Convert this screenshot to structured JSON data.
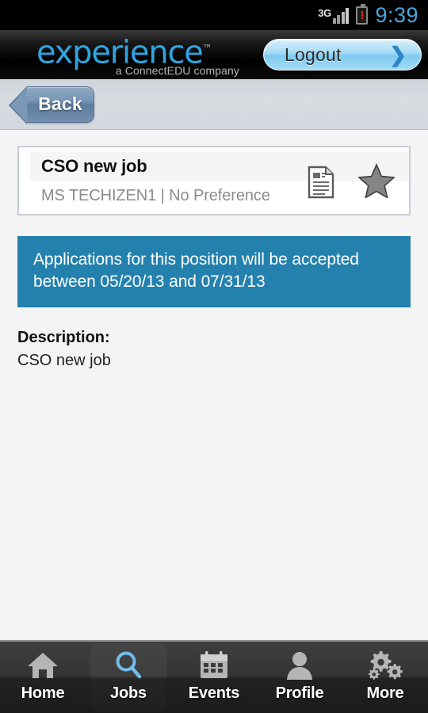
{
  "status_bar": {
    "network": "3G",
    "signal_icon": "signal-bars-icon",
    "battery_icon": "battery-alert-icon",
    "battery_alert": "!",
    "time": "9:39",
    "time_color": "#4aa8e0"
  },
  "header": {
    "logo_word": "experience",
    "logo_tm": "™",
    "logo_tagline": "a ConnectEDU company",
    "logo_color": "#2fa5e0",
    "logout_label": "Logout",
    "logout_chevron": "❯"
  },
  "nav": {
    "back_label": "Back"
  },
  "job_card": {
    "title": "CSO new job",
    "subtitle": "MS TECHIZEN1 | No Preference",
    "doc_icon": "document-icon",
    "star_icon": "star-icon",
    "star_color": "#858585"
  },
  "banner": {
    "line1": "Applications for this position will be accepted",
    "line2": "between 05/20/13 and 07/31/13",
    "background": "#2481ad"
  },
  "description": {
    "label": "Description:",
    "text": "CSO new job"
  },
  "tabbar": {
    "items": [
      {
        "label": "Home",
        "icon": "home-icon",
        "active": false
      },
      {
        "label": "Jobs",
        "icon": "search-icon",
        "active": true
      },
      {
        "label": "Events",
        "icon": "calendar-icon",
        "active": false
      },
      {
        "label": "Profile",
        "icon": "person-icon",
        "active": false
      },
      {
        "label": "More",
        "icon": "gears-icon",
        "active": false
      }
    ],
    "active_icon_color": "#6fbdec",
    "inactive_icon_color": "#b5b5b5"
  }
}
